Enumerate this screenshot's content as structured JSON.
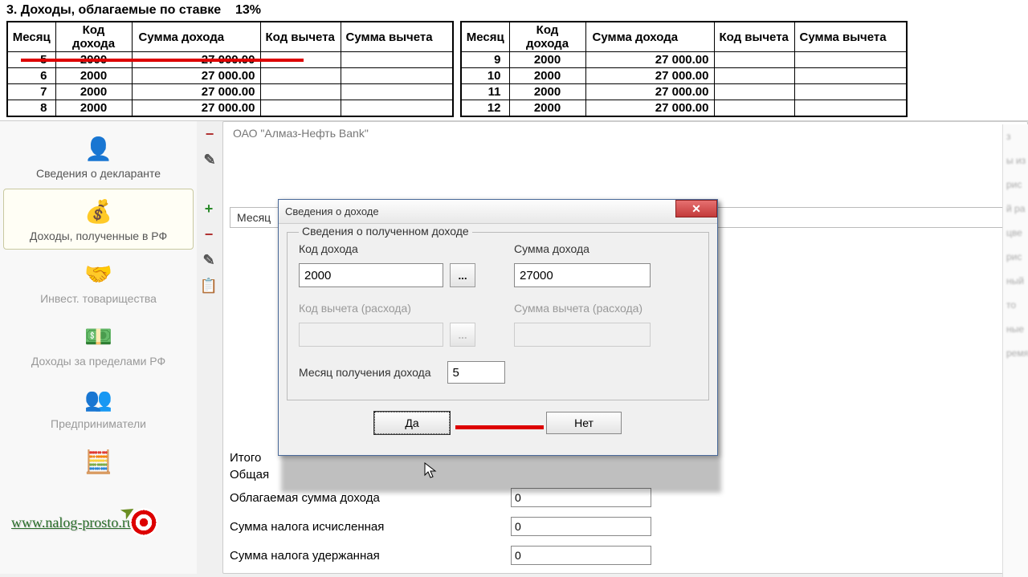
{
  "section": {
    "title": "3. Доходы, облагаемые по ставке",
    "rate": "13%"
  },
  "headers": {
    "month": "Месяц",
    "code": "Код дохода",
    "sum": "Сумма дохода",
    "dcode": "Код вычета",
    "dsum": "Сумма вычета"
  },
  "table_left": [
    {
      "month": "5",
      "code": "2000",
      "sum": "27 000.00"
    },
    {
      "month": "6",
      "code": "2000",
      "sum": "27 000.00"
    },
    {
      "month": "7",
      "code": "2000",
      "sum": "27 000.00"
    },
    {
      "month": "8",
      "code": "2000",
      "sum": "27 000.00"
    }
  ],
  "table_right": [
    {
      "month": "9",
      "code": "2000",
      "sum": "27 000.00"
    },
    {
      "month": "10",
      "code": "2000",
      "sum": "27 000.00"
    },
    {
      "month": "11",
      "code": "2000",
      "sum": "27 000.00"
    },
    {
      "month": "12",
      "code": "2000",
      "sum": "27 000.00"
    }
  ],
  "sidebar": {
    "items": [
      {
        "label": "Сведения о декларанте"
      },
      {
        "label": "Доходы, полученные в РФ"
      },
      {
        "label": "Инвест. товарищества"
      },
      {
        "label": "Доходы за пределами РФ"
      },
      {
        "label": "Предприниматели"
      }
    ]
  },
  "source_name": "ОАО \"Алмаз-Нефть Bank\"",
  "month_tabs_label": "Месяц",
  "totals": {
    "header": "Итого",
    "row0": "Общая",
    "rows": [
      {
        "label": "Облагаемая сумма дохода",
        "value": "0"
      },
      {
        "label": "Сумма налога исчисленная",
        "value": "0"
      },
      {
        "label": "Сумма налога удержанная",
        "value": "0"
      }
    ]
  },
  "dialog": {
    "title": "Сведения о доходе",
    "legend": "Сведения о полученном доходе",
    "code_label": "Код дохода",
    "code_value": "2000",
    "sum_label": "Сумма дохода",
    "sum_value": "27000",
    "dcode_label": "Код вычета (расхода)",
    "dcode_value": "",
    "dsum_label": "Сумма вычета (расхода)",
    "dsum_value": "",
    "month_label": "Месяц получения дохода",
    "month_value": "5",
    "yes": "Да",
    "no": "Нет"
  },
  "watermark": "www.nalog-prosto.ru"
}
